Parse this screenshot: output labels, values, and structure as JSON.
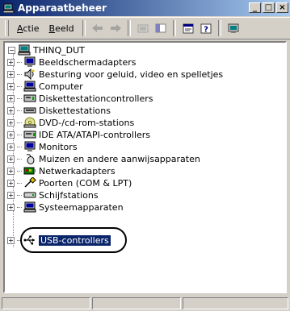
{
  "window": {
    "title": "Apparaatbeheer"
  },
  "title_buttons": [
    "_",
    "□",
    "×"
  ],
  "toolbar": {
    "menu": [
      {
        "label": "Actie",
        "accel": "A",
        "rest": "ctie"
      },
      {
        "label": "Beeld",
        "accel": "B",
        "rest": "eeld"
      }
    ],
    "buttons": [
      "back-arrow-icon",
      "forward-arrow-icon",
      "up-folder-icon",
      "tree-view-icon",
      "properties-icon",
      "help-icon",
      "scan-hardware-icon"
    ]
  },
  "tree": {
    "root": "THINQ_DUT",
    "items": [
      {
        "label": "Beeldschermadapters",
        "icon": "monitor-adapter-icon"
      },
      {
        "label": "Besturing voor geluid, video en spelletjes",
        "icon": "sound-icon"
      },
      {
        "label": "Computer",
        "icon": "computer-icon"
      },
      {
        "label": "Diskettestationcontrollers",
        "icon": "floppy-controller-icon"
      },
      {
        "label": "Diskettestations",
        "icon": "floppy-drive-icon"
      },
      {
        "label": "DVD-/cd-rom-stations",
        "icon": "cdrom-icon"
      },
      {
        "label": "IDE ATA/ATAPI-controllers",
        "icon": "ide-controller-icon"
      },
      {
        "label": "Monitors",
        "icon": "monitor-icon"
      },
      {
        "label": "Muizen en andere aanwijsapparaten",
        "icon": "mouse-icon"
      },
      {
        "label": "Netwerkadapters",
        "icon": "network-adapter-icon"
      },
      {
        "label": "Poorten (COM & LPT)",
        "icon": "port-icon"
      },
      {
        "label": "Schijfstations",
        "icon": "disk-drive-icon"
      },
      {
        "label": "Systeemapparaten",
        "icon": "system-device-icon"
      },
      {
        "label": "USB-controllers",
        "icon": "usb-icon",
        "selected": true
      }
    ]
  },
  "colors": {
    "titlebar_start": "#0a246a",
    "titlebar_end": "#a6caf0",
    "selection": "#0a246a",
    "face": "#d4d0c8"
  }
}
